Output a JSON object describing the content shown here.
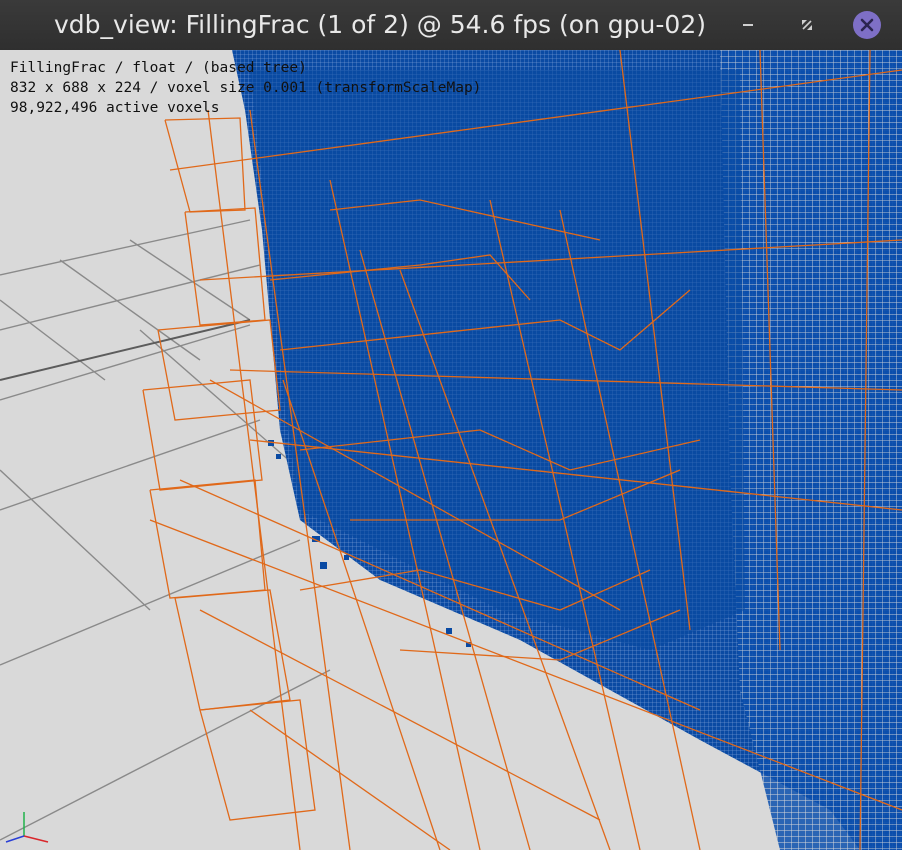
{
  "window": {
    "title": "vdb_view: FillingFrac (1 of 2) @ 54.6 fps (on gpu-02)"
  },
  "hud": {
    "line1": "FillingFrac / float / (based tree)",
    "line2": "832 x 688 x 224 / voxel size 0.001 (transformScaleMap)",
    "line3": "98,922,496 active voxels"
  },
  "colors": {
    "background": "#d9d9d9",
    "grid": "#8a8a8a",
    "voxels": "#0a4aa3",
    "tree_boxes": "#e0691a",
    "close_button": "#7e6fc6"
  },
  "icons": {
    "minimize": "minimize-icon",
    "restore": "restore-icon",
    "close": "close-icon",
    "axis": "axis-gizmo-icon"
  }
}
